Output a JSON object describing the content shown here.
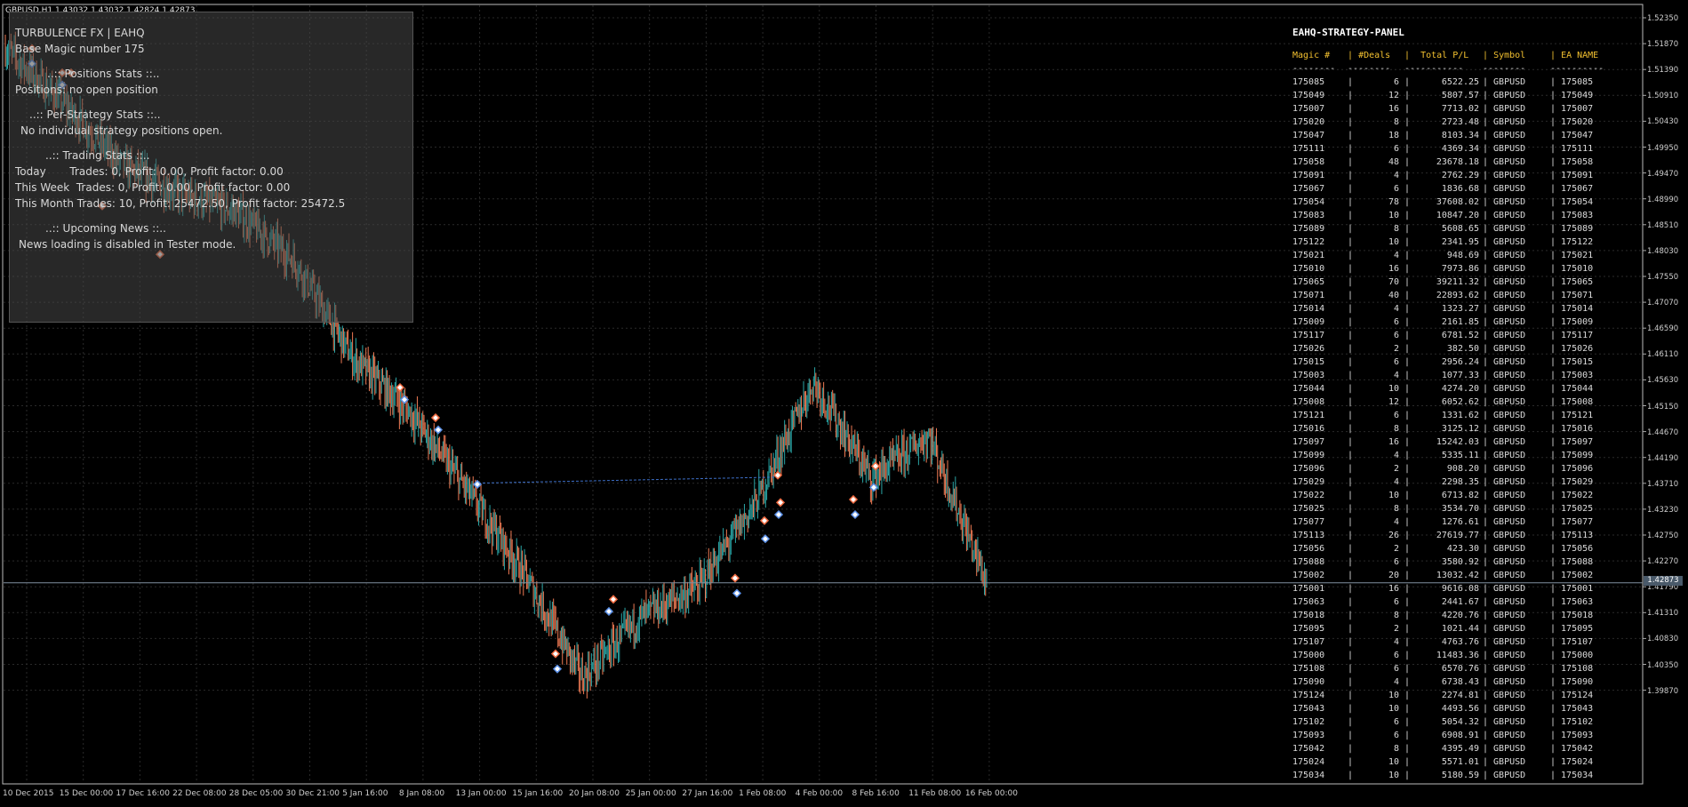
{
  "chart_header": {
    "symbol_title": "GBPUSD,H1  1.43032 1.43032 1.42824 1.42873"
  },
  "info_panel": {
    "lines": [
      "TURBULENCE FX | EAHQ",
      "Base Magic number 175",
      "..:: Positions Stats ::..",
      "Positions: no open position",
      "..:: Per-Strategy Stats ::..",
      "No individual strategy positions open.",
      "..:: Trading Stats ::..",
      "Today       Trades: 0, Profit: 0.00, Profit factor: 0.00",
      "This Week  Trades: 0, Profit: 0.00, Profit factor: 0.00",
      "This Month Trades: 10, Profit: 25472.50, Profit factor: 25472.5",
      "..:: Upcoming News ::..",
      "News loading is disabled in Tester mode."
    ]
  },
  "strategy_panel": {
    "title": "EAHQ-STRATEGY-PANEL",
    "headers": [
      "Magic #",
      "#Deals",
      "Total P/L",
      "Symbol",
      "EA NAME"
    ],
    "separators": [
      "--------",
      "--------",
      "-----------",
      "--------",
      "----------"
    ],
    "pipe": "|",
    "rows": [
      [
        "175085",
        "6",
        "6522.25",
        "GBPUSD",
        "175085"
      ],
      [
        "175049",
        "12",
        "5807.57",
        "GBPUSD",
        "175049"
      ],
      [
        "175007",
        "16",
        "7713.02",
        "GBPUSD",
        "175007"
      ],
      [
        "175020",
        "8",
        "2723.48",
        "GBPUSD",
        "175020"
      ],
      [
        "175047",
        "18",
        "8103.34",
        "GBPUSD",
        "175047"
      ],
      [
        "175111",
        "6",
        "4369.34",
        "GBPUSD",
        "175111"
      ],
      [
        "175058",
        "48",
        "23678.18",
        "GBPUSD",
        "175058"
      ],
      [
        "175091",
        "4",
        "2762.29",
        "GBPUSD",
        "175091"
      ],
      [
        "175067",
        "6",
        "1836.68",
        "GBPUSD",
        "175067"
      ],
      [
        "175054",
        "78",
        "37608.02",
        "GBPUSD",
        "175054"
      ],
      [
        "175083",
        "10",
        "10847.20",
        "GBPUSD",
        "175083"
      ],
      [
        "175089",
        "8",
        "5608.65",
        "GBPUSD",
        "175089"
      ],
      [
        "175122",
        "10",
        "2341.95",
        "GBPUSD",
        "175122"
      ],
      [
        "175021",
        "4",
        "948.69",
        "GBPUSD",
        "175021"
      ],
      [
        "175010",
        "16",
        "7973.86",
        "GBPUSD",
        "175010"
      ],
      [
        "175065",
        "70",
        "39211.32",
        "GBPUSD",
        "175065"
      ],
      [
        "175071",
        "40",
        "22893.62",
        "GBPUSD",
        "175071"
      ],
      [
        "175014",
        "4",
        "1323.27",
        "GBPUSD",
        "175014"
      ],
      [
        "175009",
        "6",
        "2161.85",
        "GBPUSD",
        "175009"
      ],
      [
        "175117",
        "6",
        "6781.52",
        "GBPUSD",
        "175117"
      ],
      [
        "175026",
        "2",
        "382.50",
        "GBPUSD",
        "175026"
      ],
      [
        "175015",
        "6",
        "2956.24",
        "GBPUSD",
        "175015"
      ],
      [
        "175003",
        "4",
        "1077.33",
        "GBPUSD",
        "175003"
      ],
      [
        "175044",
        "10",
        "4274.20",
        "GBPUSD",
        "175044"
      ],
      [
        "175008",
        "12",
        "6052.62",
        "GBPUSD",
        "175008"
      ],
      [
        "175121",
        "6",
        "1331.62",
        "GBPUSD",
        "175121"
      ],
      [
        "175016",
        "8",
        "3125.12",
        "GBPUSD",
        "175016"
      ],
      [
        "175097",
        "16",
        "15242.03",
        "GBPUSD",
        "175097"
      ],
      [
        "175099",
        "4",
        "5335.11",
        "GBPUSD",
        "175099"
      ],
      [
        "175096",
        "2",
        "908.20",
        "GBPUSD",
        "175096"
      ],
      [
        "175029",
        "4",
        "2298.35",
        "GBPUSD",
        "175029"
      ],
      [
        "175022",
        "10",
        "6713.82",
        "GBPUSD",
        "175022"
      ],
      [
        "175025",
        "8",
        "3534.70",
        "GBPUSD",
        "175025"
      ],
      [
        "175077",
        "4",
        "1276.61",
        "GBPUSD",
        "175077"
      ],
      [
        "175113",
        "26",
        "27619.77",
        "GBPUSD",
        "175113"
      ],
      [
        "175056",
        "2",
        "423.30",
        "GBPUSD",
        "175056"
      ],
      [
        "175088",
        "6",
        "3580.92",
        "GBPUSD",
        "175088"
      ],
      [
        "175002",
        "20",
        "13032.42",
        "GBPUSD",
        "175002"
      ],
      [
        "175001",
        "16",
        "9616.08",
        "GBPUSD",
        "175001"
      ],
      [
        "175063",
        "6",
        "2441.67",
        "GBPUSD",
        "175063"
      ],
      [
        "175018",
        "8",
        "4220.76",
        "GBPUSD",
        "175018"
      ],
      [
        "175095",
        "2",
        "1021.44",
        "GBPUSD",
        "175095"
      ],
      [
        "175107",
        "4",
        "4763.76",
        "GBPUSD",
        "175107"
      ],
      [
        "175000",
        "6",
        "11483.36",
        "GBPUSD",
        "175000"
      ],
      [
        "175108",
        "6",
        "6570.76",
        "GBPUSD",
        "175108"
      ],
      [
        "175090",
        "4",
        "6738.43",
        "GBPUSD",
        "175090"
      ],
      [
        "175124",
        "10",
        "2274.81",
        "GBPUSD",
        "175124"
      ],
      [
        "175043",
        "10",
        "4493.56",
        "GBPUSD",
        "175043"
      ],
      [
        "175102",
        "6",
        "5054.32",
        "GBPUSD",
        "175102"
      ],
      [
        "175093",
        "6",
        "6908.91",
        "GBPUSD",
        "175093"
      ],
      [
        "175042",
        "8",
        "4395.49",
        "GBPUSD",
        "175042"
      ],
      [
        "175024",
        "10",
        "5571.01",
        "GBPUSD",
        "175024"
      ],
      [
        "175034",
        "10",
        "5180.59",
        "GBPUSD",
        "175034"
      ]
    ]
  },
  "price_axis": {
    "labels": [
      "1.52350",
      "1.51870",
      "1.51390",
      "1.50910",
      "1.50430",
      "1.49950",
      "1.49470",
      "1.48990",
      "1.48510",
      "1.48030",
      "1.47550",
      "1.47070",
      "1.46590",
      "1.46110",
      "1.45630",
      "1.45150",
      "1.44670",
      "1.44190",
      "1.43710",
      "1.43230",
      "1.42750",
      "1.42270",
      "1.41790",
      "1.41310",
      "1.40830",
      "1.40350",
      "1.39870"
    ],
    "current_price": "1.42873"
  },
  "time_axis": {
    "labels": [
      "10 Dec 2015",
      "15 Dec 00:00",
      "17 Dec 16:00",
      "22 Dec 08:00",
      "28 Dec 05:00",
      "30 Dec 21:00",
      "5 Jan 16:00",
      "8 Jan 08:00",
      "13 Jan 00:00",
      "15 Jan 16:00",
      "20 Jan 08:00",
      "25 Jan 00:00",
      "27 Jan 16:00",
      "1 Feb 08:00",
      "4 Feb 00:00",
      "8 Feb 16:00",
      "11 Feb 08:00",
      "16 Feb 00:00"
    ]
  },
  "chart_data": {
    "type": "line",
    "ylim": [
      1.3955,
      1.5243
    ],
    "x": [
      "10 Dec 2015",
      "15 Dec 00:00",
      "17 Dec 16:00",
      "22 Dec 08:00",
      "28 Dec 05:00",
      "30 Dec 21:00",
      "5 Jan 16:00",
      "8 Jan 08:00",
      "13 Jan 00:00",
      "15 Jan 16:00",
      "20 Jan 08:00",
      "25 Jan 00:00",
      "27 Jan 16:00",
      "1 Feb 08:00",
      "4 Feb 00:00",
      "8 Feb 16:00",
      "11 Feb 08:00",
      "16 Feb 00:00"
    ],
    "series": [
      {
        "values": [
          1.517,
          1.508,
          1.498,
          1.493,
          1.49,
          1.482,
          1.466,
          1.457,
          1.444,
          1.43,
          1.413,
          1.423,
          1.428,
          1.442,
          1.462,
          1.446,
          1.453,
          1.4287
        ]
      }
    ],
    "colors": {
      "up": "#2aa6a6",
      "down": "#ee7a54",
      "buy_marker": "#5a8fe6",
      "sell_marker": "#f06a40"
    }
  }
}
